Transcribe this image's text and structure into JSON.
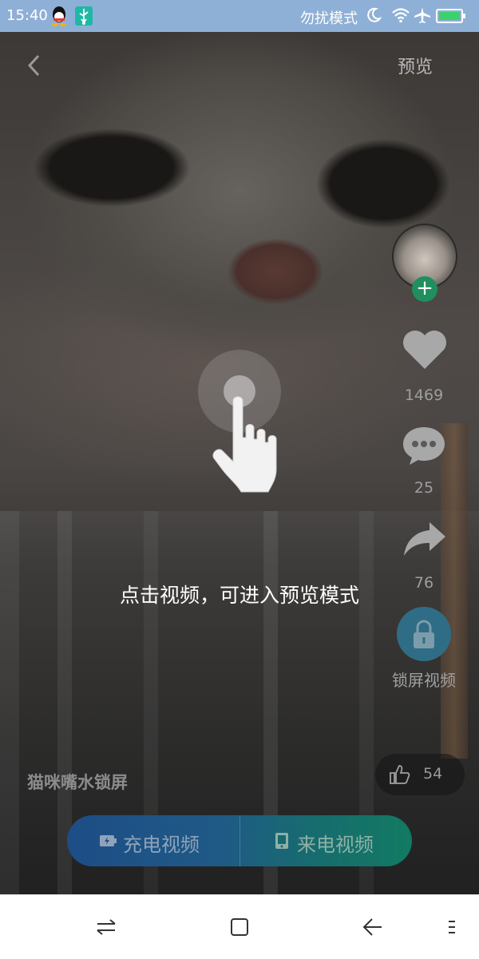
{
  "status_bar": {
    "time": "15:40",
    "dnd_label": "勿扰模式",
    "icons": [
      "qq-icon",
      "usb-icon",
      "moon-icon",
      "wifi-icon",
      "airplane-icon",
      "battery-icon"
    ]
  },
  "header": {
    "preview_label": "预览"
  },
  "side_actions": {
    "like_count": "1469",
    "comment_count": "25",
    "share_count": "76",
    "lock_video_label": "锁屏视频"
  },
  "hint": {
    "text": "点击视频，可进入预览模式"
  },
  "video": {
    "title": "猫咪嘴水锁屏",
    "like_count": "54"
  },
  "actions": {
    "charge_label": "充电视频",
    "call_label": "来电视频"
  },
  "colors": {
    "status_bar": "#8fb0d6",
    "follow_badge": "#1f8f5e",
    "lock_button": "#2f6d86",
    "action_bar_start": "#1d4d86",
    "action_bar_end": "#127a62"
  }
}
